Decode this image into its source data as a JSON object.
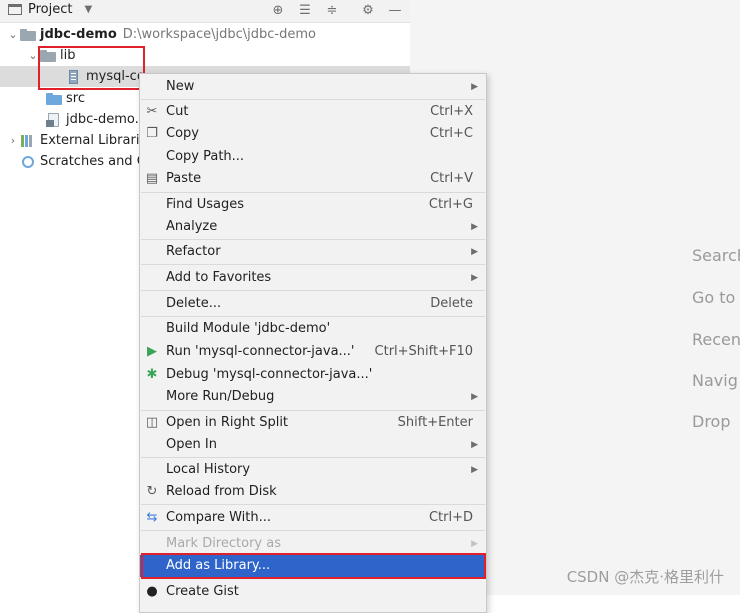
{
  "project_panel": {
    "title": "Project",
    "tree": [
      {
        "id": "root",
        "label": "jdbc-demo",
        "path": "D:\\workspace\\jdbc\\jdbc-demo",
        "expanded": true
      },
      {
        "id": "lib",
        "label": "lib",
        "expanded": true
      },
      {
        "id": "jar",
        "label": "mysql-co"
      },
      {
        "id": "src",
        "label": "src"
      },
      {
        "id": "iml",
        "label": "jdbc-demo."
      },
      {
        "id": "ext",
        "label": "External Librari"
      },
      {
        "id": "scratch",
        "label": "Scratches and C"
      }
    ]
  },
  "editor_hints": [
    "Search",
    "Go to",
    "Recen",
    "Navig",
    "Drop"
  ],
  "context_menu": {
    "items": [
      {
        "label": "New",
        "submenu": true
      },
      {
        "label": "Cut",
        "shortcut": "Ctrl+X",
        "icon": "scissors-icon"
      },
      {
        "label": "Copy",
        "shortcut": "Ctrl+C",
        "icon": "copy-icon"
      },
      {
        "label": "Copy Path..."
      },
      {
        "label": "Paste",
        "shortcut": "Ctrl+V",
        "icon": "clipboard-icon"
      },
      {
        "label": "Find Usages",
        "shortcut": "Ctrl+G"
      },
      {
        "label": "Analyze",
        "submenu": true
      },
      {
        "label": "Refactor",
        "submenu": true
      },
      {
        "label": "Add to Favorites",
        "submenu": true
      },
      {
        "label": "Delete...",
        "shortcut": "Delete"
      },
      {
        "label": "Build Module 'jdbc-demo'"
      },
      {
        "label": "Run 'mysql-connector-java...'",
        "shortcut": "Ctrl+Shift+F10",
        "icon": "run-icon"
      },
      {
        "label": "Debug 'mysql-connector-java...'",
        "icon": "debug-icon"
      },
      {
        "label": "More Run/Debug",
        "submenu": true
      },
      {
        "label": "Open in Right Split",
        "shortcut": "Shift+Enter",
        "icon": "split-icon"
      },
      {
        "label": "Open In",
        "submenu": true
      },
      {
        "label": "Local History",
        "submenu": true
      },
      {
        "label": "Reload from Disk",
        "icon": "reload-icon"
      },
      {
        "label": "Compare With...",
        "shortcut": "Ctrl+D",
        "icon": "compare-icon"
      },
      {
        "label": "Mark Directory as",
        "submenu": true,
        "disabled": true
      },
      {
        "label": "Add as Library...",
        "selected": true
      },
      {
        "label": "Create Gist",
        "icon": "github-icon"
      }
    ]
  },
  "watermark": "CSDN @杰克·格里利什",
  "colors": {
    "selection": "#2f65ca",
    "annotation_red": "#e0202a"
  }
}
